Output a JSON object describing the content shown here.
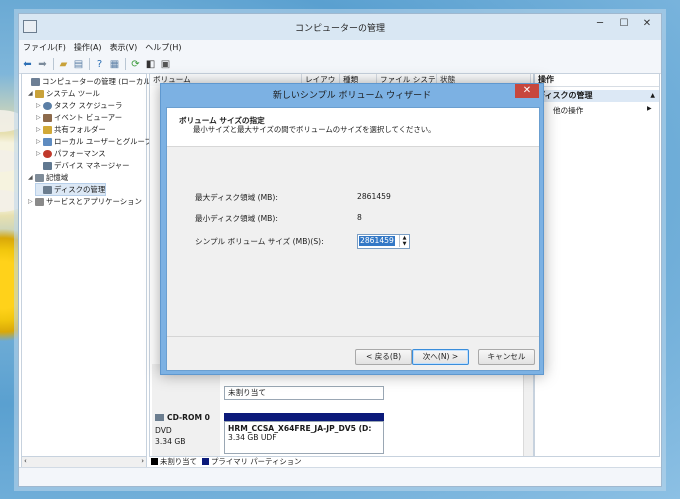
{
  "window": {
    "title": "コンピューターの管理",
    "minimize": "─",
    "maximize": "☐",
    "close": "✕"
  },
  "menu": [
    "ファイル(F)",
    "操作(A)",
    "表示(V)",
    "ヘルプ(H)"
  ],
  "tree": [
    {
      "label": "コンピューターの管理 (ローカル)",
      "color": "#6d7f95",
      "tri": ""
    },
    {
      "label": "システム ツール",
      "color": "#c9a23a",
      "tri": "◢"
    },
    {
      "label": "タスク スケジューラ",
      "color": "#5b7fa6",
      "tri": "▷"
    },
    {
      "label": "イベント ビューアー",
      "color": "#8d6a4b",
      "tri": "▷"
    },
    {
      "label": "共有フォルダー",
      "color": "#d1a938",
      "tri": "▷"
    },
    {
      "label": "ローカル ユーザーとグループ",
      "color": "#5e8bc0",
      "tri": "▷"
    },
    {
      "label": "パフォーマンス",
      "color": "#c0392b",
      "tri": "▷"
    },
    {
      "label": "デバイス マネージャー",
      "color": "#607890",
      "tri": ""
    },
    {
      "label": "記憶域",
      "color": "#7f8c99",
      "tri": "◢"
    },
    {
      "label": "ディスクの管理",
      "color": "#6b7d8f",
      "tri": ""
    },
    {
      "label": "サービスとアプリケーション",
      "color": "#8a8a8a",
      "tri": "▷"
    }
  ],
  "columns": [
    "ボリューム",
    "レイアウト",
    "種類",
    "ファイル システム",
    "状態"
  ],
  "disk": {
    "cd_label": "CD-ROM 0",
    "cd_type": "DVD",
    "cd_size": "3.34 GB",
    "volume_name": "HRM_CCSA_X64FRE_JA-JP_DV5 (D:",
    "volume_detail": "3.34 GB UDF",
    "unalloc_label": "未割り当て"
  },
  "legend": {
    "unallocated": "未割り当て",
    "primary": "プライマリ パーティション"
  },
  "actions": {
    "header": "操作",
    "selected": "ディスクの管理",
    "other": "他の操作"
  },
  "dialog": {
    "title": "新しいシンプル ボリューム ウィザード",
    "close": "✕",
    "heading": "ボリューム サイズの指定",
    "subheading": "最小サイズと最大サイズの間でボリュームのサイズを選択してください。",
    "max_label": "最大ディスク領域 (MB):",
    "max_value": "2861459",
    "min_label": "最小ディスク領域 (MB):",
    "min_value": "8",
    "size_label": "シンプル ボリューム サイズ (MB)(S):",
    "size_value": "2861459",
    "back": "< 戻る(B)",
    "next": "次へ(N) >",
    "cancel": "キャンセル"
  },
  "colors": {
    "primary_partition": "#0b1a7a",
    "unallocated": "#000000",
    "dialog_frame": "#7cb1e3"
  }
}
